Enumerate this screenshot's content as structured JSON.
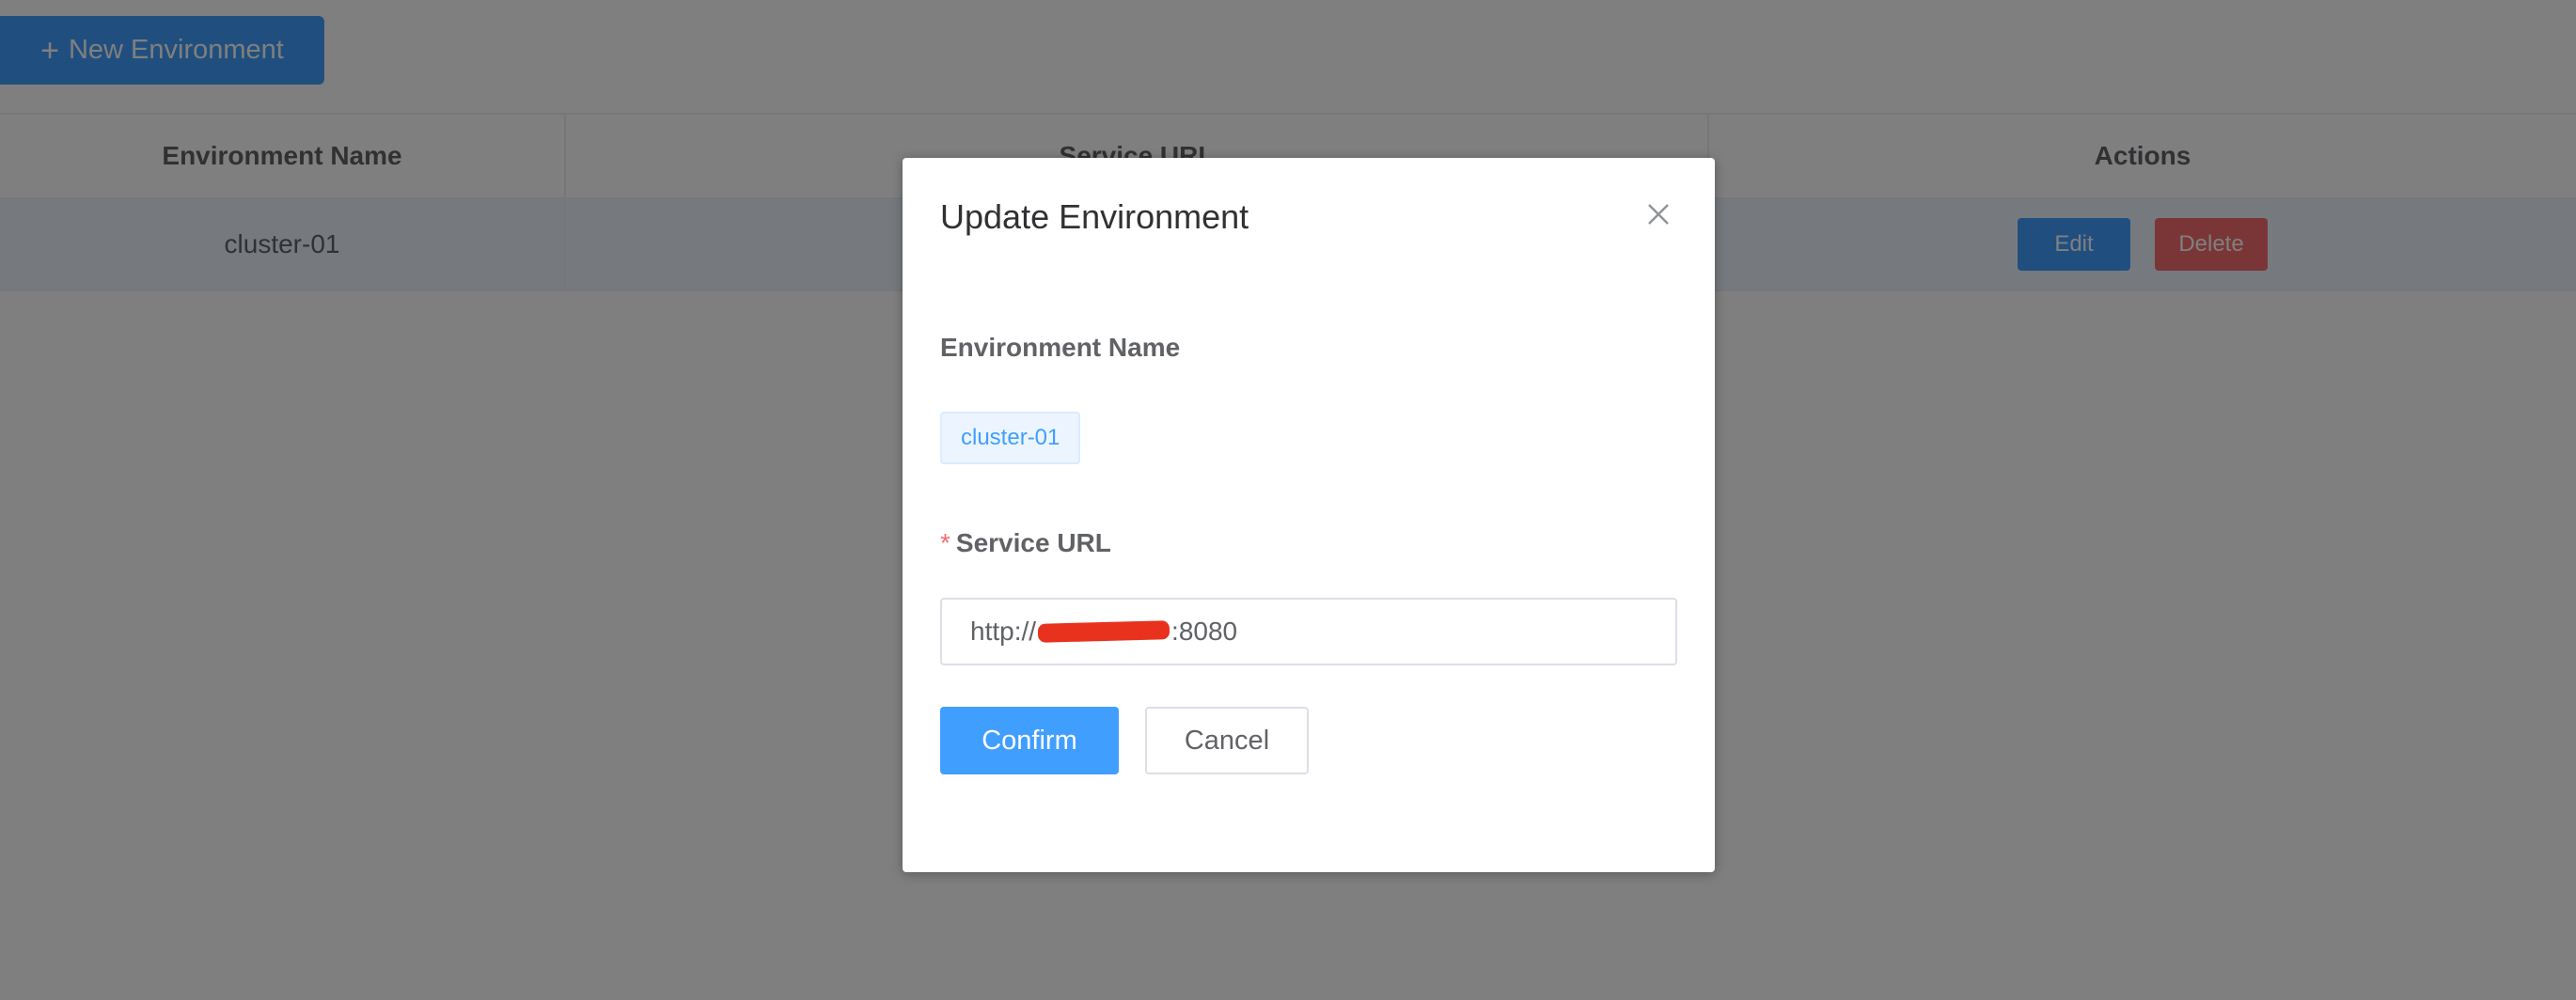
{
  "toolbar": {
    "new_button_label": "New Environment",
    "new_button_icon": "plus-icon"
  },
  "table": {
    "columns": [
      "Environment Name",
      "Service URL",
      "Actions"
    ],
    "rows": [
      {
        "name": "cluster-01",
        "edit_label": "Edit",
        "delete_label": "Delete"
      }
    ]
  },
  "dialog": {
    "title": "Update Environment",
    "close_icon": "close-icon",
    "name_label": "Environment Name",
    "name_value": "cluster-01",
    "url_label": "Service URL",
    "url_required_mark": "*",
    "url_value_prefix": "http://",
    "url_value_suffix": ":8080",
    "confirm_label": "Confirm",
    "cancel_label": "Cancel"
  },
  "colors": {
    "primary": "#409eff",
    "danger": "#f56c6c",
    "redaction": "#e8321e"
  }
}
